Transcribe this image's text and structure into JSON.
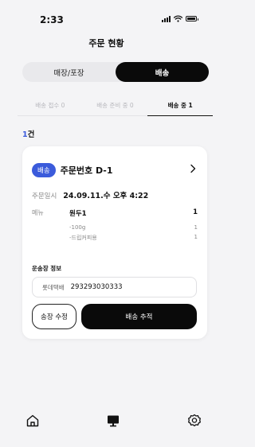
{
  "status_bar": {
    "time": "2:33"
  },
  "header": {
    "title": "주문 현황"
  },
  "segmented": {
    "options": [
      "매장/포장",
      "배송"
    ],
    "selected": "배송"
  },
  "status_tabs": [
    {
      "label": "배송 접수 0",
      "active": false
    },
    {
      "label": "배송 준비 중 0",
      "active": false
    },
    {
      "label": "배송 중 1",
      "active": true
    }
  ],
  "count": {
    "number": "1",
    "suffix": "건"
  },
  "order": {
    "badge": "배송",
    "order_number": "주문번호 D-1",
    "date_label": "주문일시",
    "date_value": "24.09.11.수 오후 4:22",
    "menu_label": "메뉴",
    "item_name": "원두1",
    "item_qty": "1",
    "options": [
      {
        "name": "-100g",
        "qty": "1"
      },
      {
        "name": "-드립커피용",
        "qty": "1"
      }
    ],
    "shipping_label": "운송장 정보",
    "courier": "롯데택배",
    "tracking_number": "293293030333",
    "edit_button": "송장 수정",
    "track_button": "배송 추적"
  },
  "nav": {
    "icons": [
      "home-icon",
      "monitor-icon",
      "settings-icon"
    ]
  },
  "colors": {
    "accent": "#3b5bdb",
    "primary": "#0a0a0a",
    "background": "#f4f4f6"
  }
}
